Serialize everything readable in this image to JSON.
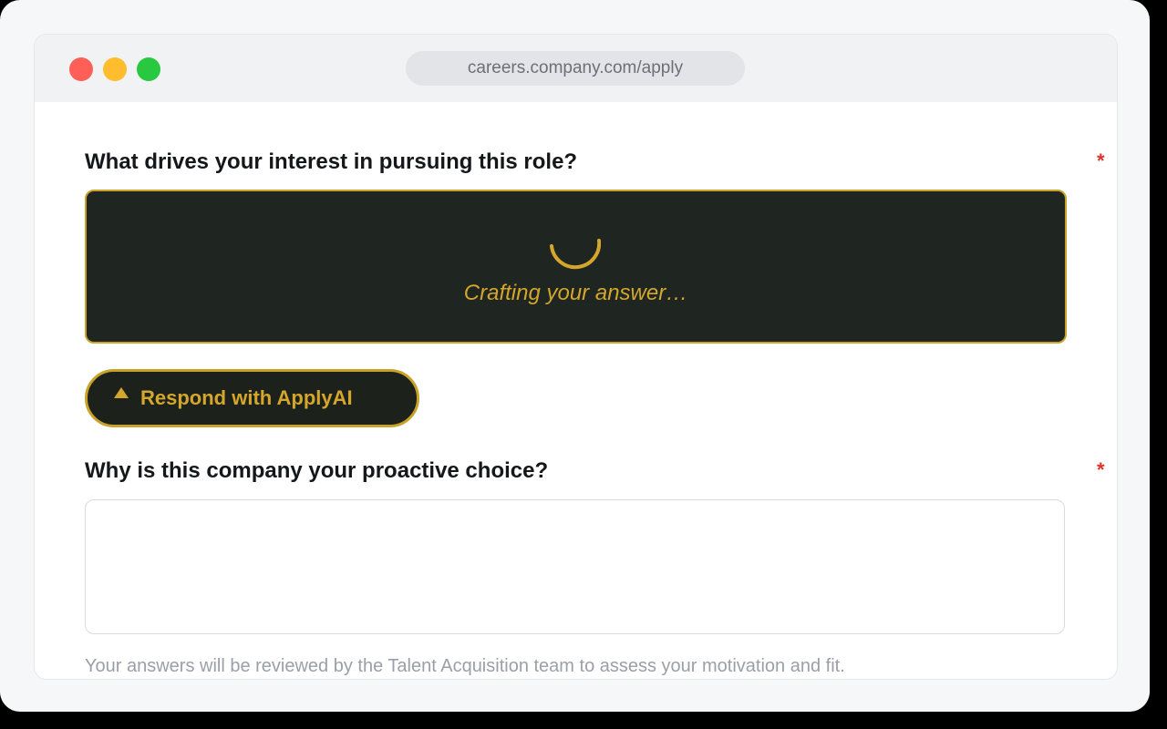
{
  "browser": {
    "url": "careers.company.com/apply",
    "traffic_lights": [
      "close",
      "minimize",
      "maximize"
    ]
  },
  "form": {
    "questions": [
      {
        "label": "What drives your interest in pursuing this role?",
        "required_mark": "*",
        "state": "loading",
        "loading_text": "Crafting your answer…"
      },
      {
        "label": "Why is this company your proactive choice?",
        "required_mark": "*",
        "state": "empty",
        "value": ""
      }
    ],
    "ai_button": {
      "label": "Respond with ApplyAI",
      "icon": "triangle-up-icon"
    },
    "footnote": "Your answers will be reviewed by the Talent Acquisition team to assess your motivation and fit."
  },
  "colors": {
    "accent_gold": "#d4a72c",
    "dark_panel": "#1f2520",
    "required_red": "#e0322f"
  }
}
